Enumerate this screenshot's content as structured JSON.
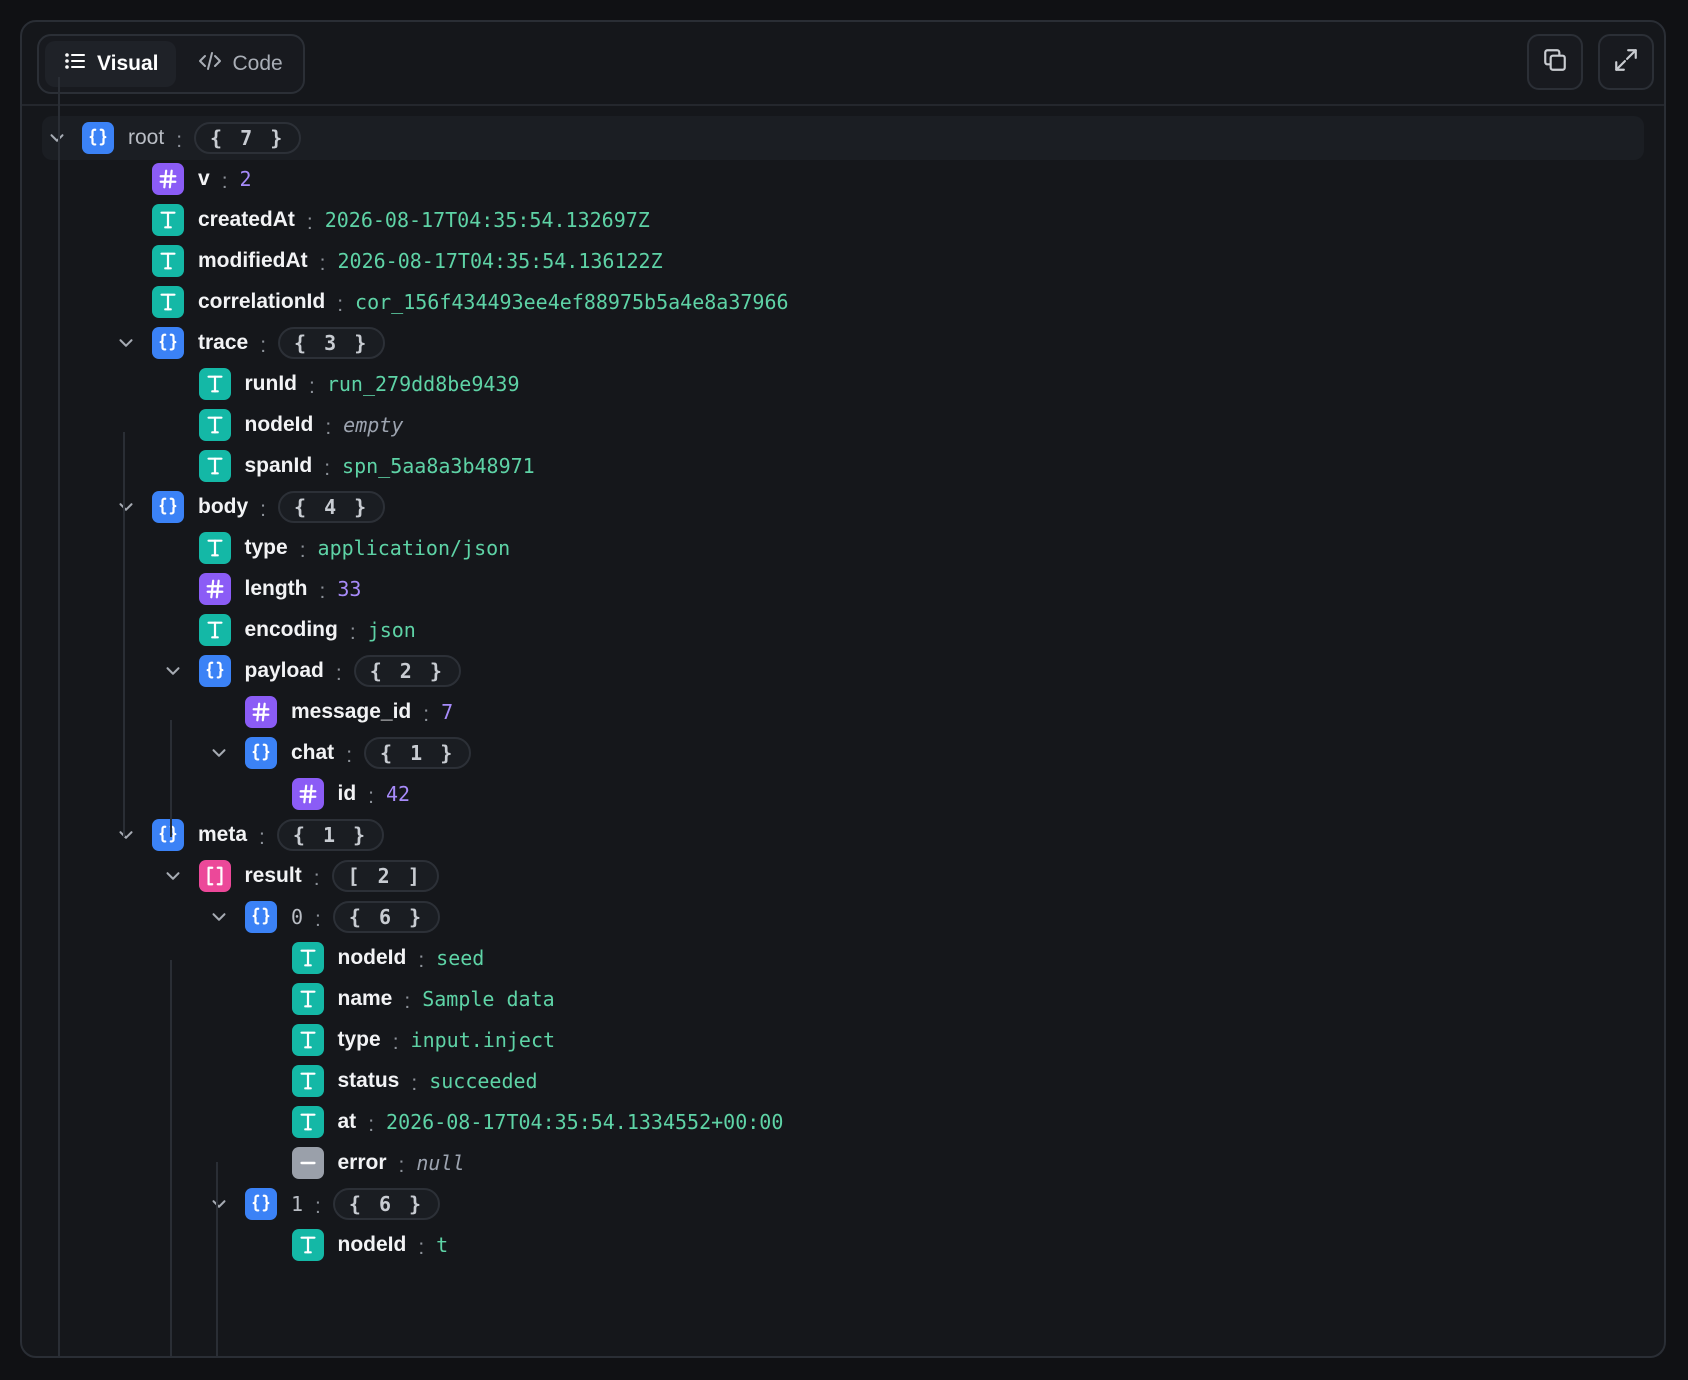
{
  "toolbar": {
    "tabs": [
      {
        "label": "Visual",
        "icon": "list-icon",
        "active": true
      },
      {
        "label": "Code",
        "icon": "code-icon",
        "active": false
      }
    ],
    "actions": [
      {
        "name": "copy-button",
        "icon": "copy-icon"
      },
      {
        "name": "expand-button",
        "icon": "expand-icon"
      }
    ]
  },
  "colors": {
    "object": "#3b82f6",
    "string": "#14b8a6",
    "number": "#8b5cf6",
    "array": "#ec4899",
    "null": "#9aa0aa"
  },
  "tree": {
    "root": {
      "key": "root",
      "count": "{ 7 }"
    },
    "v": {
      "key": "v",
      "value": "2"
    },
    "createdAt": {
      "key": "createdAt",
      "value": "2026-08-17T04:35:54.132697Z"
    },
    "modifiedAt": {
      "key": "modifiedAt",
      "value": "2026-08-17T04:35:54.136122Z"
    },
    "correlationId": {
      "key": "correlationId",
      "value": "cor_156f434493ee4ef88975b5a4e8a37966"
    },
    "trace": {
      "key": "trace",
      "count": "{ 3 }",
      "runId": {
        "key": "runId",
        "value": "run_279dd8be9439"
      },
      "nodeId": {
        "key": "nodeId",
        "value": "empty"
      },
      "spanId": {
        "key": "spanId",
        "value": "spn_5aa8a3b48971"
      }
    },
    "body": {
      "key": "body",
      "count": "{ 4 }",
      "type": {
        "key": "type",
        "value": "application/json"
      },
      "length": {
        "key": "length",
        "value": "33"
      },
      "encoding": {
        "key": "encoding",
        "value": "json"
      },
      "payload": {
        "key": "payload",
        "count": "{ 2 }",
        "message_id": {
          "key": "message_id",
          "value": "7"
        },
        "chat": {
          "key": "chat",
          "count": "{ 1 }",
          "id": {
            "key": "id",
            "value": "42"
          }
        }
      }
    },
    "meta": {
      "key": "meta",
      "count": "{ 1 }",
      "result": {
        "key": "result",
        "count": "[ 2 ]",
        "item0": {
          "key": "0",
          "count": "{ 6 }",
          "nodeId": {
            "key": "nodeId",
            "value": "seed"
          },
          "name": {
            "key": "name",
            "value": "Sample data"
          },
          "type": {
            "key": "type",
            "value": "input.inject"
          },
          "status": {
            "key": "status",
            "value": "succeeded"
          },
          "at": {
            "key": "at",
            "value": "2026-08-17T04:35:54.1334552+00:00"
          },
          "error": {
            "key": "error",
            "value": "null"
          }
        },
        "item1": {
          "key": "1",
          "count": "{ 6 }",
          "nodeId": {
            "key": "nodeId",
            "value": "t"
          }
        }
      }
    }
  }
}
